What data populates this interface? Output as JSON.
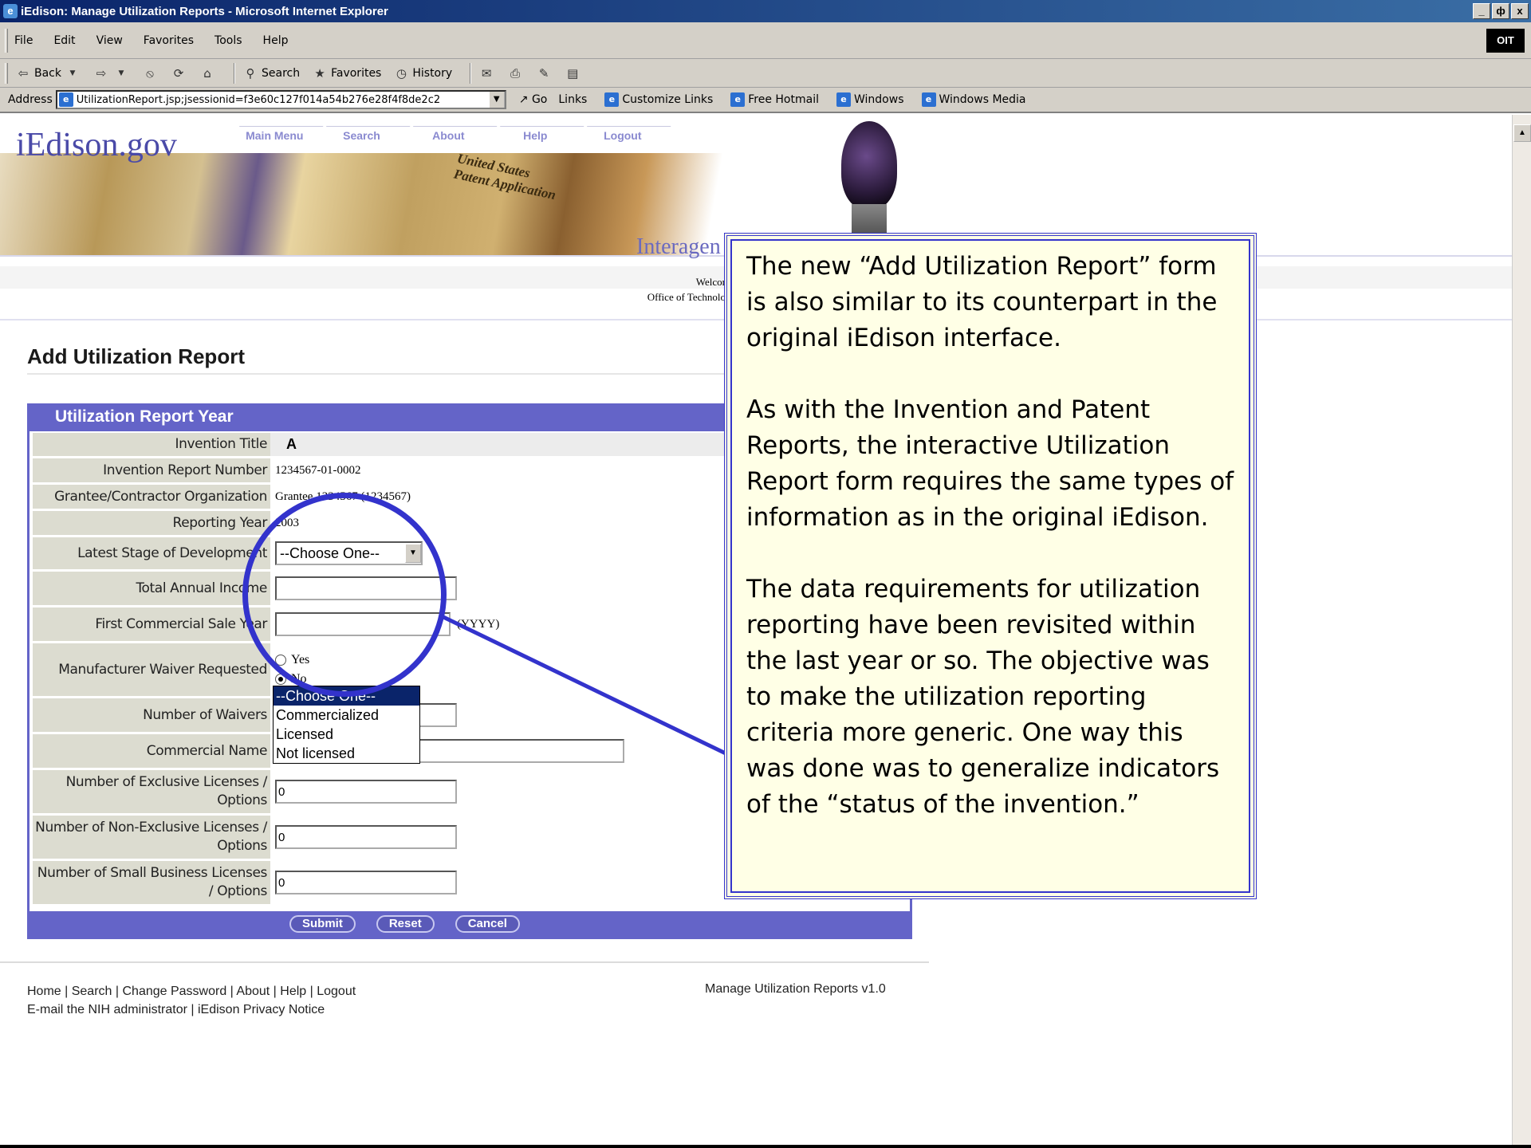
{
  "window": {
    "title": "iEdison: Manage Utilization Reports - Microsoft Internet Explorer",
    "min": "_",
    "max": "ф",
    "close": "x"
  },
  "menu": [
    "File",
    "Edit",
    "View",
    "Favorites",
    "Tools",
    "Help"
  ],
  "badge": "OIT",
  "toolbar": {
    "back": "Back",
    "search": "Search",
    "favorites": "Favorites",
    "history": "History"
  },
  "address": {
    "label": "Address",
    "url": "UtilizationReport.jsp;jsessionid=f3e60c127f014a54b276e28f4f8de2c2",
    "go": "Go",
    "links_label": "Links",
    "links": [
      "Customize Links",
      "Free Hotmail",
      "Windows",
      "Windows Media"
    ]
  },
  "site": {
    "logo": "iEdison.gov",
    "nav": [
      "Main Menu",
      "Search",
      "About",
      "Help",
      "Logout"
    ],
    "banner_text_1": "United States",
    "banner_text_2": "Patent Application",
    "interagency": "Interagen",
    "welcome_1": "Welcor",
    "welcome_2": "Office of Technolo"
  },
  "form": {
    "title": "Add Utilization Report",
    "section": "Utilization Report Year",
    "labels": {
      "invention_title": "Invention Title",
      "invention_report_number": "Invention Report Number",
      "grantee": "Grantee/Contractor Organization",
      "reporting_year": "Reporting Year",
      "latest_stage": "Latest Stage of Development",
      "total_income": "Total Annual Income",
      "first_sale_year": "First Commercial Sale Year",
      "waiver_requested": "Manufacturer Waiver Requested",
      "num_waivers": "Number of Waivers",
      "commercial_name": "Commercial Name",
      "exclusive_licenses": "Number of Exclusive Licenses / Options",
      "non_exclusive": "Number of Non-Exclusive Licenses / Options",
      "small_business": "Number of Small Business Licenses / Options"
    },
    "values": {
      "invention_title": "A",
      "invention_report_number": "1234567-01-0002",
      "grantee": "Grantee 1234567 (1234567)",
      "reporting_year": "2003",
      "latest_stage": "--Choose One--",
      "first_sale_hint": "(YYYY)",
      "radio_yes": "Yes",
      "radio_no": "No",
      "num_waivers": "0",
      "commercial_name": "",
      "exclusive_licenses": "0",
      "non_exclusive": "0",
      "small_business": "0"
    },
    "dropdown_options": [
      "--Choose One--",
      "Commercialized",
      "Licensed",
      "Not licensed"
    ],
    "buttons": {
      "submit": "Submit",
      "reset": "Reset",
      "cancel": "Cancel"
    }
  },
  "footer": {
    "links_line1": [
      "Home",
      "Search",
      "Change Password",
      "About",
      "Help",
      "Logout"
    ],
    "links_line2": [
      "E-mail the NIH administrator",
      "iEdison Privacy Notice"
    ],
    "version": "Manage Utilization Reports v1.0"
  },
  "note": {
    "p1": "The new “Add Utilization Report” form is also similar to its counterpart in the original iEdison interface.",
    "p2": "As with the Invention and Patent Reports, the interactive Utilization Report form requires the same types of information as in the original iEdison.",
    "p3": "The data requirements for utilization reporting have been revisited within the last year or so.  The objective was to make the utilization reporting criteria more generic.  One way this was done was to generalize indicators of the “status of the invention.”"
  },
  "colors": {
    "accent": "#6464c8",
    "callout": "#3333cc",
    "note_bg": "#ffffe6",
    "titlebar": "#0a246a"
  }
}
